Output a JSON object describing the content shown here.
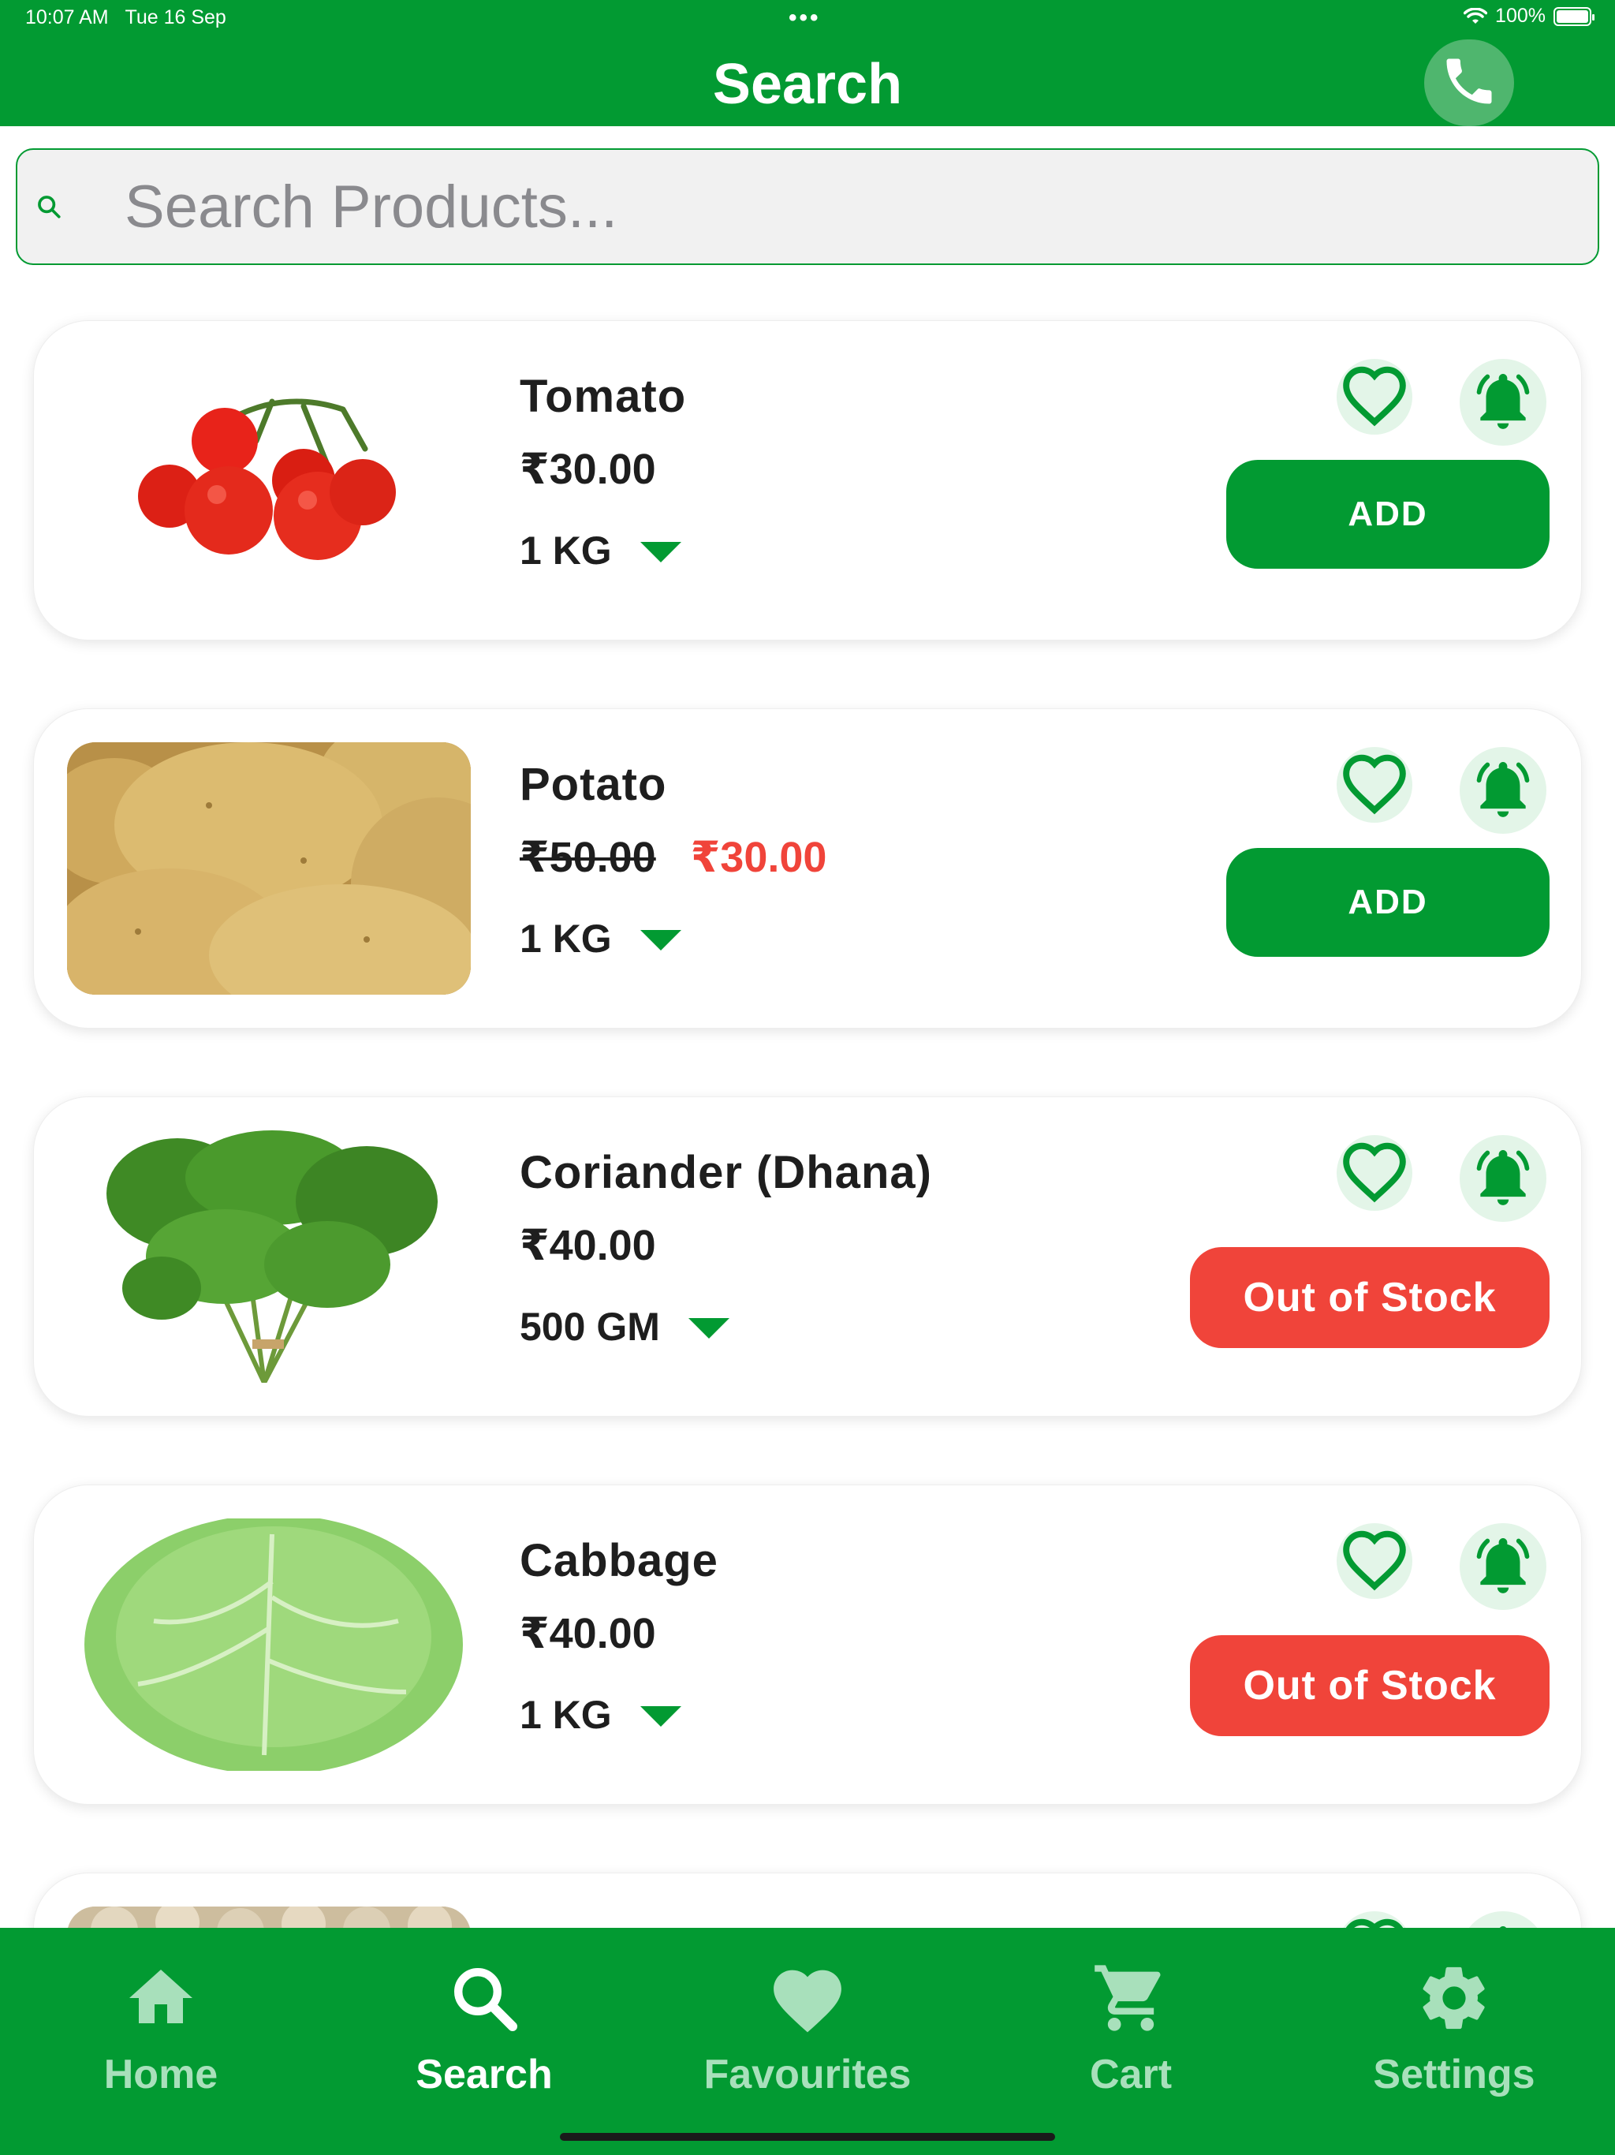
{
  "status_bar": {
    "time": "10:07 AM",
    "date": "Tue 16 Sep",
    "multitask_dots": "•••",
    "battery_percent": "100%"
  },
  "header": {
    "title": "Search"
  },
  "search": {
    "placeholder": "Search Products..."
  },
  "products": [
    {
      "name": "Tomato",
      "price": "₹30.00",
      "original_price": "",
      "unit": "1 KG",
      "action": "ADD",
      "in_stock": true
    },
    {
      "name": "Potato",
      "price": "₹30.00",
      "original_price": "₹50.00",
      "unit": "1 KG",
      "action": "ADD",
      "in_stock": true
    },
    {
      "name": "Coriander (Dhana)",
      "price": "₹40.00",
      "original_price": "",
      "unit": "500 GM",
      "action": "Out of Stock",
      "in_stock": false
    },
    {
      "name": "Cabbage",
      "price": "₹40.00",
      "original_price": "",
      "unit": "1 KG",
      "action": "Out of Stock",
      "in_stock": false
    }
  ],
  "bottom_nav": [
    {
      "label": "Home",
      "icon": "home-icon",
      "active": false
    },
    {
      "label": "Search",
      "icon": "search-icon",
      "active": true
    },
    {
      "label": "Favourites",
      "icon": "heart-icon",
      "active": false
    },
    {
      "label": "Cart",
      "icon": "cart-icon",
      "active": false
    },
    {
      "label": "Settings",
      "icon": "gear-icon",
      "active": false
    }
  ],
  "colors": {
    "brand_green": "#029a32",
    "sale_red": "#f0443a",
    "inactive_nav": "#a8e0bb",
    "active_nav": "#ffffff",
    "icon_bg": "#e3f5e8"
  }
}
